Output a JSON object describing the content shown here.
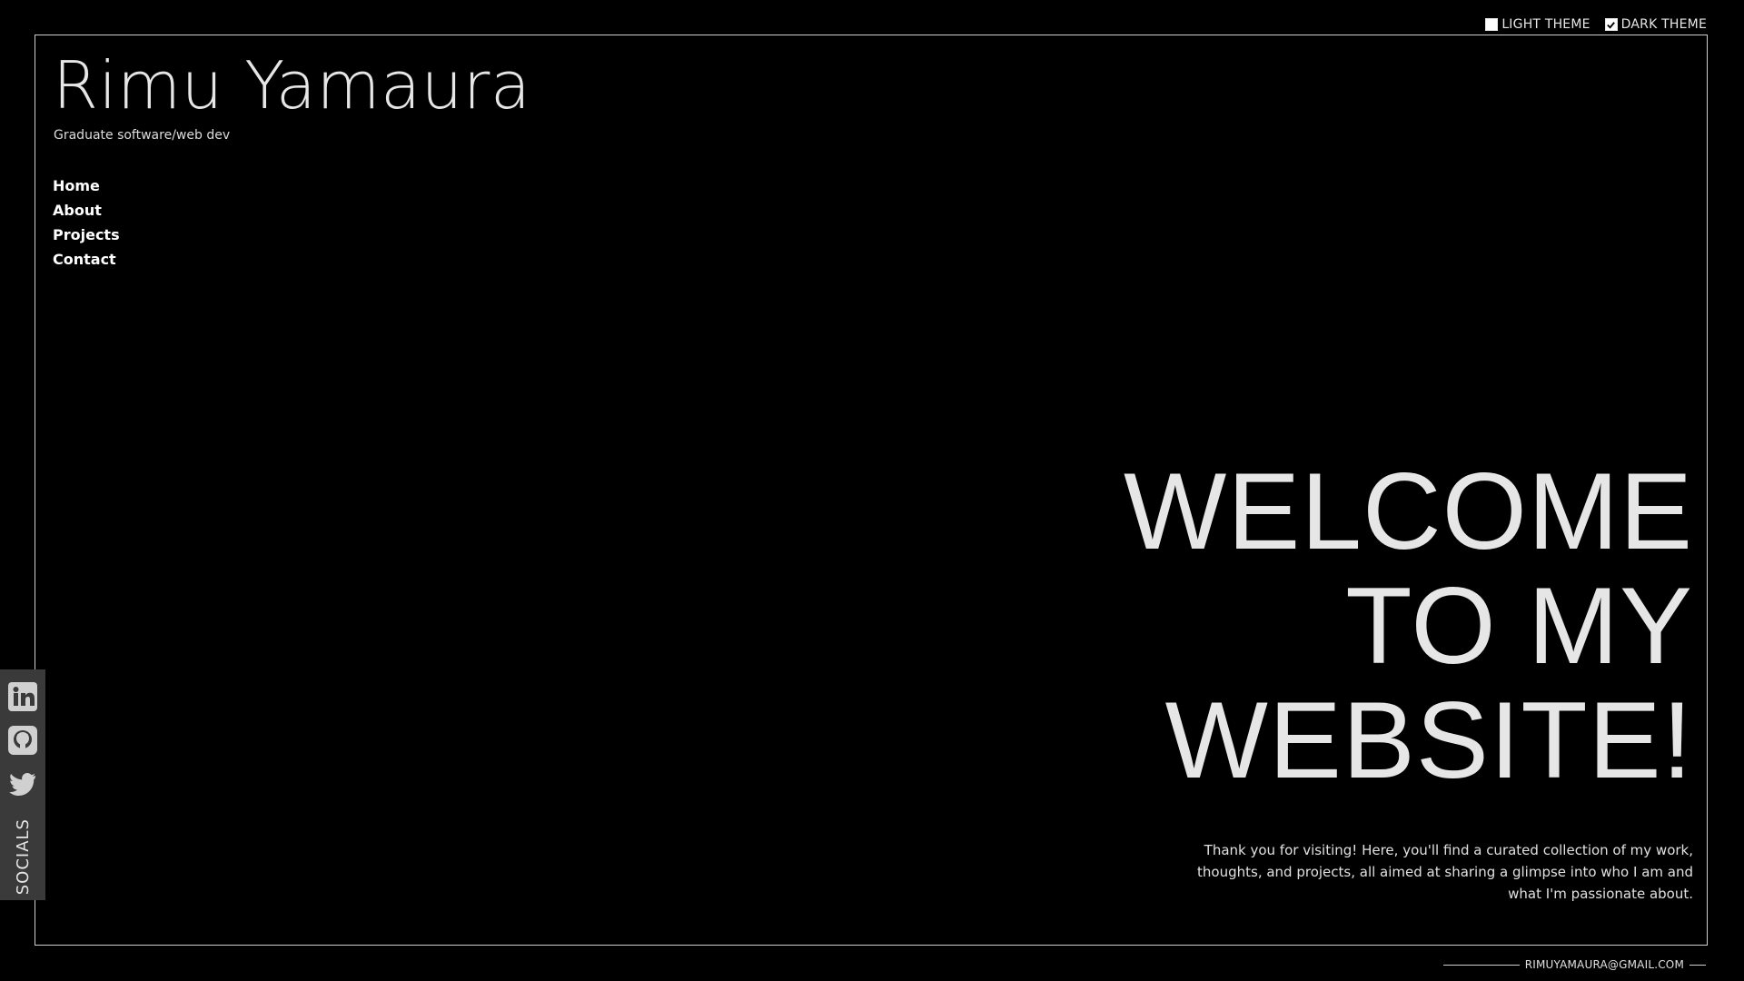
{
  "theme": {
    "light_label": "LIGHT THEME",
    "dark_label": "DARK THEME",
    "selected": "dark",
    "colors": {
      "background": "#000000",
      "text": "#e6e6e6",
      "frame_border": "#cfcfcf",
      "socials_bg": "#3a3a3a"
    }
  },
  "header": {
    "title": "Rimu Yamaura",
    "subtitle": "Graduate software/web dev"
  },
  "nav": {
    "items": [
      "Home",
      "About",
      "Projects",
      "Contact"
    ]
  },
  "hero": {
    "lines": [
      "WELCOME",
      "TO MY",
      "WEBSITE!"
    ],
    "lead": "Thank you for visiting! Here, you'll find a curated collection of my work, thoughts, and projects, all aimed at sharing a glimpse into who I am and what I'm passionate about."
  },
  "socials": {
    "label": "SOCIALS",
    "items": [
      {
        "name": "linkedin-icon"
      },
      {
        "name": "github-icon"
      },
      {
        "name": "twitter-icon"
      }
    ]
  },
  "footer": {
    "email": "RIMUYAMAURA@GMAIL.COM"
  }
}
